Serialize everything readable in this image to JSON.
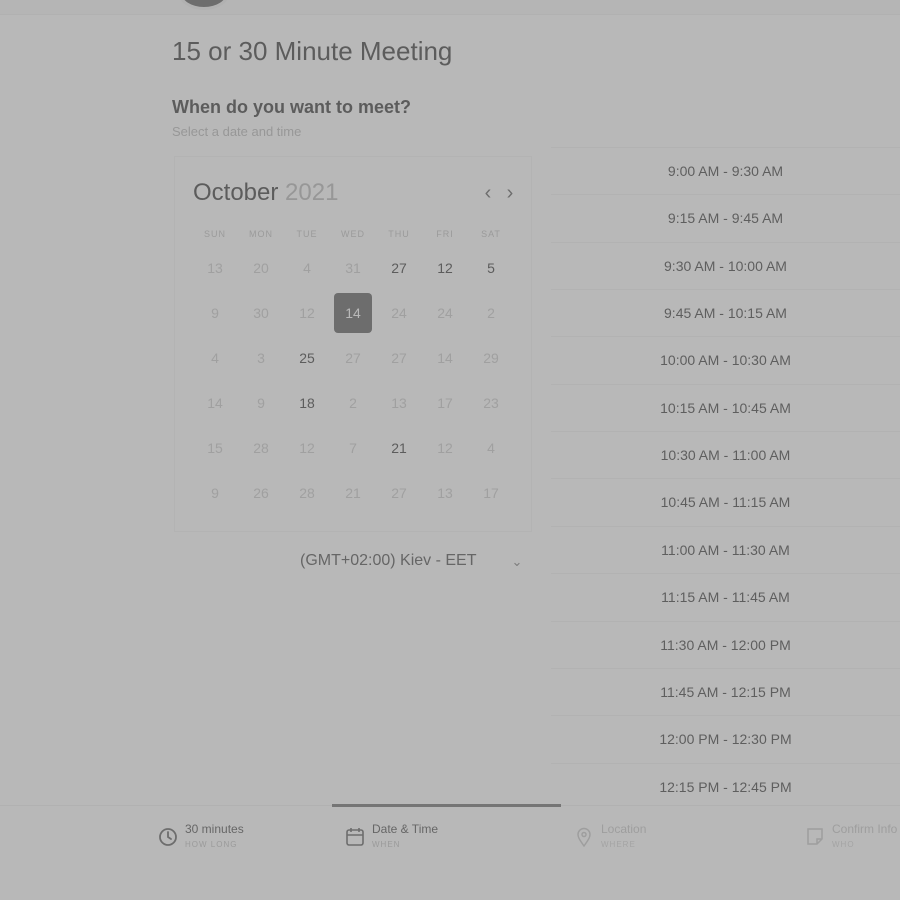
{
  "meeting": {
    "title": "15 or 30 Minute Meeting",
    "question": "When do you want to meet?",
    "hint": "Select a date and time"
  },
  "calendar": {
    "month": "October",
    "year": "2021",
    "weekdays": [
      "SUN",
      "MON",
      "TUE",
      "WED",
      "THU",
      "FRI",
      "SAT"
    ],
    "days": [
      {
        "label": "13",
        "available": false
      },
      {
        "label": "20",
        "available": false
      },
      {
        "label": "4",
        "available": false
      },
      {
        "label": "31",
        "available": false
      },
      {
        "label": "27",
        "available": true
      },
      {
        "label": "12",
        "available": true
      },
      {
        "label": "5",
        "available": true
      },
      {
        "label": "9",
        "available": false
      },
      {
        "label": "30",
        "available": false
      },
      {
        "label": "12",
        "available": false
      },
      {
        "label": "14",
        "available": true,
        "selected": true
      },
      {
        "label": "24",
        "available": false
      },
      {
        "label": "24",
        "available": false
      },
      {
        "label": "2",
        "available": false
      },
      {
        "label": "4",
        "available": false
      },
      {
        "label": "3",
        "available": false
      },
      {
        "label": "25",
        "available": true
      },
      {
        "label": "27",
        "available": false
      },
      {
        "label": "27",
        "available": false
      },
      {
        "label": "14",
        "available": false
      },
      {
        "label": "29",
        "available": false
      },
      {
        "label": "14",
        "available": false
      },
      {
        "label": "9",
        "available": false
      },
      {
        "label": "18",
        "available": true
      },
      {
        "label": "2",
        "available": false
      },
      {
        "label": "13",
        "available": false
      },
      {
        "label": "17",
        "available": false
      },
      {
        "label": "23",
        "available": false
      },
      {
        "label": "15",
        "available": false
      },
      {
        "label": "28",
        "available": false
      },
      {
        "label": "12",
        "available": false
      },
      {
        "label": "7",
        "available": false
      },
      {
        "label": "21",
        "available": true
      },
      {
        "label": "12",
        "available": false
      },
      {
        "label": "4",
        "available": false
      },
      {
        "label": "9",
        "available": false
      },
      {
        "label": "26",
        "available": false
      },
      {
        "label": "28",
        "available": false
      },
      {
        "label": "21",
        "available": false
      },
      {
        "label": "27",
        "available": false
      },
      {
        "label": "13",
        "available": false
      },
      {
        "label": "17",
        "available": false
      }
    ]
  },
  "timezone": {
    "value": "(GMT+02:00) Kiev - EET"
  },
  "timeslots": [
    "9:00 AM - 9:30 AM",
    "9:15 AM - 9:45 AM",
    "9:30 AM - 10:00 AM",
    "9:45 AM - 10:15 AM",
    "10:00 AM - 10:30 AM",
    "10:15 AM - 10:45 AM",
    "10:30 AM - 11:00 AM",
    "10:45 AM - 11:15 AM",
    "11:00 AM - 11:30 AM",
    "11:15 AM - 11:45 AM",
    "11:30 AM - 12:00 PM",
    "11:45 AM - 12:15 PM",
    "12:00 PM - 12:30 PM",
    "12:15 PM - 12:45 PM"
  ],
  "steps": [
    {
      "label": "30 minutes",
      "sub": "HOW LONG",
      "icon": "clock-icon"
    },
    {
      "label": "Date & Time",
      "sub": "WHEN",
      "icon": "calendar-icon"
    },
    {
      "label": "Location",
      "sub": "WHERE",
      "icon": "location-pin-icon"
    },
    {
      "label": "Confirm Info",
      "sub": "WHO",
      "icon": "document-icon"
    }
  ],
  "icons": {
    "prev": "chevron-left-icon",
    "next": "chevron-right-icon",
    "timezone_dropdown": "chevron-down-icon"
  },
  "colors": {
    "accent": "#555555",
    "overlay": "#808080"
  }
}
